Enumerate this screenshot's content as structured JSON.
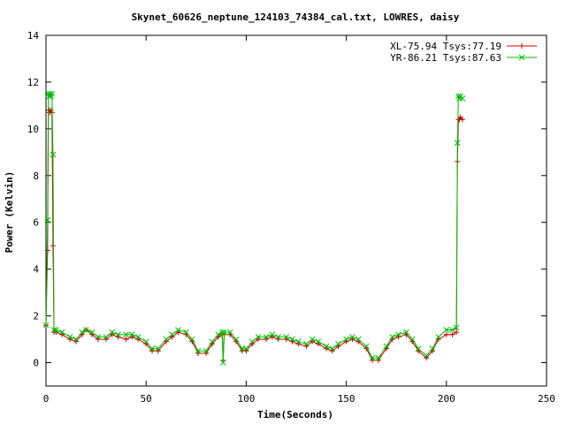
{
  "chart_data": {
    "type": "line",
    "title": "Skynet_60626_neptune_124103_74384_cal.txt, LOWRES, daisy",
    "xlabel": "Time(Seconds)",
    "ylabel": "Power (Kelvin)",
    "xlim": [
      0,
      250
    ],
    "ylim": [
      -1,
      14
    ],
    "x_ticks": [
      0,
      50,
      100,
      150,
      200,
      250
    ],
    "y_ticks": [
      0,
      2,
      4,
      6,
      8,
      10,
      12,
      14
    ],
    "grid": false,
    "legend_position": "top-right",
    "series": [
      {
        "name": "XL-75.94 Tsys:77.19",
        "color": "#cc0000",
        "marker": "plus",
        "x": [
          0,
          0.8,
          1.2,
          1.6,
          2.0,
          2.5,
          3.0,
          3.5,
          4,
          5,
          8,
          12,
          15,
          18,
          20,
          23,
          26,
          30,
          33,
          36,
          40,
          43,
          46,
          50,
          53,
          56,
          60,
          63,
          66,
          70,
          73,
          76,
          80,
          83,
          86,
          88,
          88.5,
          89,
          92,
          95,
          98,
          100,
          103,
          106,
          110,
          113,
          116,
          120,
          123,
          126,
          130,
          133,
          136,
          140,
          143,
          146,
          150,
          153,
          156,
          160,
          163,
          166,
          170,
          173,
          176,
          180,
          183,
          186,
          190,
          193,
          196,
          200,
          203,
          205,
          205.5,
          206,
          206.5,
          207,
          208
        ],
        "y": [
          1.6,
          4.8,
          10.7,
          10.8,
          10.7,
          10.8,
          10.7,
          5.0,
          1.3,
          1.3,
          1.2,
          1.0,
          0.9,
          1.2,
          1.4,
          1.2,
          1.0,
          1.0,
          1.2,
          1.1,
          1.0,
          1.1,
          1.0,
          0.8,
          0.5,
          0.5,
          0.9,
          1.1,
          1.3,
          1.2,
          0.9,
          0.4,
          0.4,
          0.8,
          1.1,
          1.2,
          0.1,
          1.2,
          1.2,
          0.9,
          0.5,
          0.5,
          0.8,
          1.0,
          1.0,
          1.1,
          1.0,
          1.0,
          0.9,
          0.8,
          0.7,
          0.9,
          0.8,
          0.6,
          0.5,
          0.7,
          0.9,
          1.0,
          0.9,
          0.6,
          0.1,
          0.1,
          0.6,
          1.0,
          1.1,
          1.2,
          0.9,
          0.5,
          0.2,
          0.5,
          1.0,
          1.2,
          1.2,
          1.3,
          8.6,
          10.4,
          10.4,
          10.5,
          10.4
        ]
      },
      {
        "name": "YR-86.21 Tsys:87.63",
        "color": "#00bb00",
        "marker": "cross",
        "x": [
          0,
          0.8,
          1.2,
          1.6,
          2.0,
          2.5,
          3.0,
          3.5,
          4,
          5,
          8,
          12,
          15,
          18,
          20,
          23,
          26,
          30,
          33,
          36,
          40,
          43,
          46,
          50,
          53,
          56,
          60,
          63,
          66,
          70,
          73,
          76,
          80,
          83,
          86,
          88,
          88.5,
          89,
          92,
          95,
          98,
          100,
          103,
          106,
          110,
          113,
          116,
          120,
          123,
          126,
          130,
          133,
          136,
          140,
          143,
          146,
          150,
          153,
          156,
          160,
          163,
          166,
          170,
          173,
          176,
          180,
          183,
          186,
          190,
          193,
          196,
          200,
          203,
          205,
          205.5,
          206,
          206.5,
          207,
          208
        ],
        "y": [
          1.6,
          6.1,
          11.5,
          11.4,
          11.5,
          11.4,
          11.5,
          8.9,
          1.4,
          1.4,
          1.3,
          1.1,
          1.0,
          1.3,
          1.4,
          1.3,
          1.1,
          1.1,
          1.3,
          1.2,
          1.2,
          1.2,
          1.1,
          0.9,
          0.6,
          0.6,
          1.0,
          1.2,
          1.4,
          1.3,
          1.0,
          0.5,
          0.5,
          0.9,
          1.2,
          1.3,
          0.0,
          1.3,
          1.3,
          1.0,
          0.6,
          0.6,
          0.9,
          1.1,
          1.1,
          1.2,
          1.1,
          1.1,
          1.0,
          0.9,
          0.8,
          1.0,
          0.9,
          0.7,
          0.6,
          0.8,
          1.0,
          1.1,
          1.0,
          0.7,
          0.2,
          0.2,
          0.7,
          1.1,
          1.2,
          1.3,
          1.0,
          0.6,
          0.3,
          0.6,
          1.1,
          1.4,
          1.4,
          1.5,
          9.4,
          11.4,
          11.3,
          11.4,
          11.3
        ]
      }
    ]
  }
}
